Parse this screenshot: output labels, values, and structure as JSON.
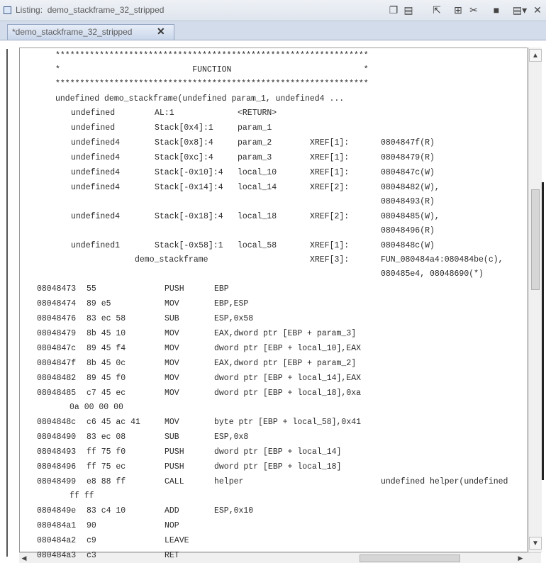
{
  "window": {
    "title": "Listing:  demo_stackframe_32_stripped",
    "tab_label": "*demo_stackframe_32_stripped",
    "close_glyph": "✕"
  },
  "listing": {
    "banner": [
      "****************************************************************",
      "*                           FUNCTION                           *",
      "****************************************************************"
    ],
    "signature": "undefined demo_stackframe(undefined param_1, undefined4 ...",
    "variables": [
      {
        "type": "undefined",
        "storage": "AL:1",
        "name": "<RETURN>",
        "xref": "",
        "refs": []
      },
      {
        "type": "undefined",
        "storage": "Stack[0x4]:1",
        "name": "param_1",
        "xref": "",
        "refs": []
      },
      {
        "type": "undefined4",
        "storage": "Stack[0x8]:4",
        "name": "param_2",
        "xref": "XREF[1]:",
        "refs": [
          "0804847f(R)"
        ]
      },
      {
        "type": "undefined4",
        "storage": "Stack[0xc]:4",
        "name": "param_3",
        "xref": "XREF[1]:",
        "refs": [
          "08048479(R)"
        ]
      },
      {
        "type": "undefined4",
        "storage": "Stack[-0x10]:4",
        "name": "local_10",
        "xref": "XREF[1]:",
        "refs": [
          "0804847c(W)"
        ]
      },
      {
        "type": "undefined4",
        "storage": "Stack[-0x14]:4",
        "name": "local_14",
        "xref": "XREF[2]:",
        "refs": [
          "08048482(W),",
          "08048493(R)"
        ]
      },
      {
        "type": "undefined4",
        "storage": "Stack[-0x18]:4",
        "name": "local_18",
        "xref": "XREF[2]:",
        "refs": [
          "08048485(W),",
          "08048496(R)"
        ]
      },
      {
        "type": "undefined1",
        "storage": "Stack[-0x58]:1",
        "name": "local_58",
        "xref": "XREF[1]:",
        "refs": [
          "0804848c(W)"
        ]
      }
    ],
    "label": {
      "name": "demo_stackframe",
      "xref": "XREF[3]:",
      "refs": [
        "FUN_080484a4:080484be(c),",
        "080485e4, 08048690(*)"
      ]
    },
    "instructions": [
      {
        "addr": "08048473",
        "bytes": "55",
        "mnemonic": "PUSH",
        "operands": "EBP",
        "comment": ""
      },
      {
        "addr": "08048474",
        "bytes": "89 e5",
        "mnemonic": "MOV",
        "operands": "EBP,ESP",
        "comment": ""
      },
      {
        "addr": "08048476",
        "bytes": "83 ec 58",
        "mnemonic": "SUB",
        "operands": "ESP,0x58",
        "comment": ""
      },
      {
        "addr": "08048479",
        "bytes": "8b 45 10",
        "mnemonic": "MOV",
        "operands": "EAX,dword ptr [EBP + param_3]",
        "comment": ""
      },
      {
        "addr": "0804847c",
        "bytes": "89 45 f4",
        "mnemonic": "MOV",
        "operands": "dword ptr [EBP + local_10],EAX",
        "comment": ""
      },
      {
        "addr": "0804847f",
        "bytes": "8b 45 0c",
        "mnemonic": "MOV",
        "operands": "EAX,dword ptr [EBP + param_2]",
        "comment": ""
      },
      {
        "addr": "08048482",
        "bytes": "89 45 f0",
        "mnemonic": "MOV",
        "operands": "dword ptr [EBP + local_14],EAX",
        "comment": ""
      },
      {
        "addr": "08048485",
        "bytes": "c7 45 ec",
        "mnemonic": "MOV",
        "operands": "dword ptr [EBP + local_18],0xa",
        "comment": ""
      },
      {
        "addr": "",
        "bytes": "0a 00 00 00",
        "mnemonic": "",
        "operands": "",
        "comment": ""
      },
      {
        "addr": "0804848c",
        "bytes": "c6 45 ac 41",
        "mnemonic": "MOV",
        "operands": "byte ptr [EBP + local_58],0x41",
        "comment": ""
      },
      {
        "addr": "08048490",
        "bytes": "83 ec 08",
        "mnemonic": "SUB",
        "operands": "ESP,0x8",
        "comment": ""
      },
      {
        "addr": "08048493",
        "bytes": "ff 75 f0",
        "mnemonic": "PUSH",
        "operands": "dword ptr [EBP + local_14]",
        "comment": ""
      },
      {
        "addr": "08048496",
        "bytes": "ff 75 ec",
        "mnemonic": "PUSH",
        "operands": "dword ptr [EBP + local_18]",
        "comment": ""
      },
      {
        "addr": "08048499",
        "bytes": "e8 88 ff",
        "mnemonic": "CALL",
        "operands": "helper",
        "comment": "undefined helper(undefined"
      },
      {
        "addr": "",
        "bytes": "ff ff",
        "mnemonic": "",
        "operands": "",
        "comment": ""
      },
      {
        "addr": "0804849e",
        "bytes": "83 c4 10",
        "mnemonic": "ADD",
        "operands": "ESP,0x10",
        "comment": ""
      },
      {
        "addr": "080484a1",
        "bytes": "90",
        "mnemonic": "NOP",
        "operands": "",
        "comment": ""
      },
      {
        "addr": "080484a2",
        "bytes": "c9",
        "mnemonic": "LEAVE",
        "operands": "",
        "comment": ""
      },
      {
        "addr": "080484a3",
        "bytes": "c3",
        "mnemonic": "RET",
        "operands": "",
        "comment": ""
      }
    ]
  },
  "toolbar": {
    "icons": [
      "copy-icon",
      "paste-icon",
      "cursor-icon",
      "layout-icon",
      "scissors-icon",
      "snapshot-icon",
      "menu-icon",
      "close-icon"
    ],
    "glyphs": [
      "❐",
      "▤",
      "⇱",
      "⊞",
      "✂",
      "■",
      "▤▾",
      "✕"
    ]
  },
  "scrollbar": {
    "up": "▲",
    "down": "▼",
    "left": "◀",
    "right": "▶"
  }
}
